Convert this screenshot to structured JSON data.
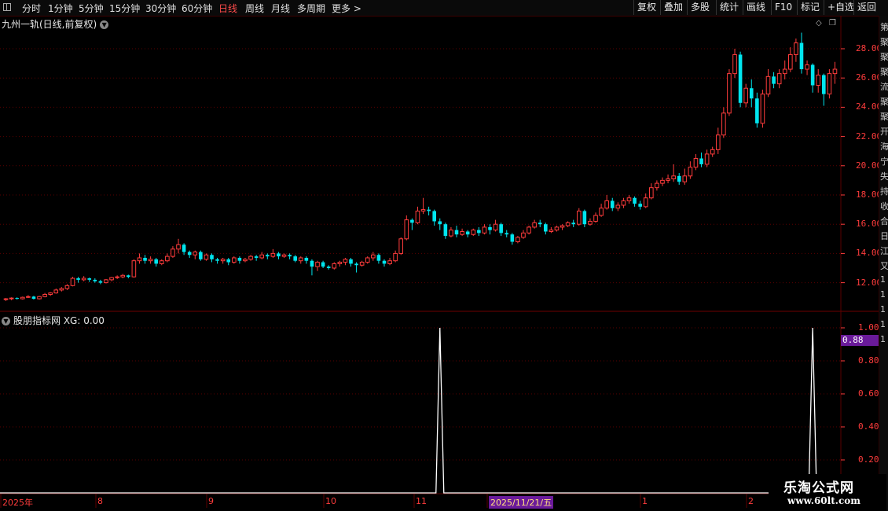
{
  "toolbar": {
    "periods": [
      "分时",
      "1分钟",
      "5分钟",
      "15分钟",
      "30分钟",
      "60分钟",
      "日线",
      "周线",
      "月线",
      "多周期",
      "更多 >"
    ],
    "active_index": 6,
    "right_buttons": [
      "复权",
      "叠加",
      "多股",
      "统计",
      "画线",
      "F10",
      "标记",
      "+自选",
      "返回"
    ]
  },
  "chart": {
    "title": "九州一轨(日线,前复权)",
    "indicator_title": "股朋指标网  XG: 0.00",
    "price_ticks": [
      "28.00",
      "26.00",
      "24.00",
      "22.00",
      "20.00",
      "18.00",
      "16.00",
      "14.00",
      "12.00"
    ],
    "indicator_ticks": [
      "1.00",
      "0.80",
      "0.60",
      "0.40",
      "0.20"
    ],
    "cursor_value": "0.88",
    "date_labels": [
      "2025年",
      "8",
      "9",
      "10",
      "11",
      "2025/11/21/五",
      "1",
      "2"
    ],
    "side_strip": [
      "第",
      "聚",
      "聚",
      "聚",
      "流",
      "聚",
      "聚",
      "开",
      "海",
      "宁",
      "失",
      "持",
      "收",
      "合",
      "日",
      "江",
      "又",
      "1",
      "1",
      "1",
      "1",
      "1"
    ],
    "watermark_title": "乐淘公式网",
    "watermark_url": "www.60lt.com",
    "colors": {
      "up": "#ff3c3c",
      "down": "#00e5ee",
      "signal": "#ffffff",
      "grid": "#5a0000",
      "tag": "#6a1a9a"
    }
  },
  "chart_data": [
    {
      "type": "candlestick",
      "title": "九州一轨(日线,前复权)",
      "ylim": [
        10.5,
        29.5
      ],
      "candles": [
        [
          10.85,
          10.9,
          10.75,
          10.95
        ],
        [
          10.9,
          10.95,
          10.8,
          11.0
        ],
        [
          10.95,
          10.9,
          10.85,
          11.0
        ],
        [
          10.9,
          11.0,
          10.85,
          11.05
        ],
        [
          11.0,
          11.05,
          10.95,
          11.15
        ],
        [
          11.05,
          10.9,
          10.85,
          11.1
        ],
        [
          10.9,
          11.05,
          10.85,
          11.1
        ],
        [
          11.05,
          11.2,
          11.0,
          11.3
        ],
        [
          11.2,
          11.3,
          11.1,
          11.35
        ],
        [
          11.3,
          11.5,
          11.25,
          11.6
        ],
        [
          11.5,
          11.6,
          11.4,
          11.7
        ],
        [
          11.6,
          11.8,
          11.5,
          11.9
        ],
        [
          11.8,
          12.3,
          11.75,
          12.4
        ],
        [
          12.3,
          12.2,
          12.0,
          12.4
        ],
        [
          12.2,
          12.3,
          12.1,
          12.45
        ],
        [
          12.3,
          12.2,
          12.05,
          12.35
        ],
        [
          12.2,
          12.1,
          12.0,
          12.3
        ],
        [
          12.1,
          12.0,
          11.9,
          12.2
        ],
        [
          12.0,
          12.2,
          11.95,
          12.25
        ],
        [
          12.2,
          12.35,
          12.1,
          12.4
        ],
        [
          12.35,
          12.4,
          12.25,
          12.5
        ],
        [
          12.4,
          12.5,
          12.3,
          12.6
        ],
        [
          12.5,
          12.4,
          12.3,
          12.55
        ],
        [
          12.4,
          13.5,
          12.35,
          13.6
        ],
        [
          13.5,
          13.7,
          13.3,
          14.0
        ],
        [
          13.7,
          13.5,
          13.3,
          13.9
        ],
        [
          13.5,
          13.6,
          13.3,
          13.8
        ],
        [
          13.6,
          13.3,
          13.1,
          13.7
        ],
        [
          13.3,
          13.5,
          13.2,
          13.6
        ],
        [
          13.5,
          13.8,
          13.4,
          14.0
        ],
        [
          13.8,
          14.3,
          13.7,
          14.5
        ],
        [
          14.3,
          14.6,
          14.0,
          15.0
        ],
        [
          14.6,
          14.1,
          13.9,
          14.7
        ],
        [
          14.1,
          13.9,
          13.7,
          14.2
        ],
        [
          13.9,
          14.1,
          13.6,
          14.2
        ],
        [
          14.1,
          13.6,
          13.5,
          14.2
        ],
        [
          13.6,
          13.9,
          13.5,
          14.0
        ],
        [
          13.9,
          13.6,
          13.4,
          14.0
        ],
        [
          13.6,
          13.5,
          13.3,
          13.7
        ],
        [
          13.5,
          13.6,
          13.3,
          13.7
        ],
        [
          13.6,
          13.4,
          13.2,
          13.7
        ],
        [
          13.4,
          13.7,
          13.3,
          13.8
        ],
        [
          13.7,
          13.5,
          13.3,
          13.8
        ],
        [
          13.5,
          13.6,
          13.4,
          13.7
        ],
        [
          13.6,
          13.8,
          13.5,
          13.9
        ],
        [
          13.8,
          13.7,
          13.5,
          13.9
        ],
        [
          13.7,
          13.9,
          13.6,
          14.1
        ],
        [
          13.9,
          13.8,
          13.6,
          14.0
        ],
        [
          13.8,
          14.0,
          13.7,
          14.3
        ],
        [
          14.0,
          13.8,
          13.6,
          14.1
        ],
        [
          13.8,
          13.9,
          13.7,
          14.0
        ],
        [
          13.9,
          13.8,
          13.6,
          14.0
        ],
        [
          13.8,
          13.5,
          13.4,
          13.9
        ],
        [
          13.5,
          13.7,
          13.3,
          13.8
        ],
        [
          13.7,
          13.5,
          13.3,
          13.8
        ],
        [
          13.5,
          13.1,
          12.5,
          13.6
        ],
        [
          13.1,
          13.4,
          12.8,
          13.5
        ],
        [
          13.4,
          13.1,
          13.0,
          13.5
        ],
        [
          13.1,
          13.0,
          12.9,
          13.2
        ],
        [
          13.0,
          13.3,
          12.9,
          13.4
        ],
        [
          13.3,
          13.4,
          13.1,
          13.5
        ],
        [
          13.4,
          13.6,
          13.2,
          13.7
        ],
        [
          13.6,
          13.3,
          13.1,
          13.7
        ],
        [
          13.3,
          13.2,
          12.7,
          13.4
        ],
        [
          13.2,
          13.4,
          13.1,
          13.5
        ],
        [
          13.4,
          13.7,
          13.3,
          13.8
        ],
        [
          13.7,
          13.9,
          13.5,
          14.1
        ],
        [
          13.9,
          13.5,
          13.3,
          14.0
        ],
        [
          13.5,
          13.3,
          13.1,
          13.6
        ],
        [
          13.3,
          13.5,
          13.2,
          13.7
        ],
        [
          13.5,
          14.0,
          13.4,
          14.2
        ],
        [
          14.0,
          15.0,
          13.9,
          15.1
        ],
        [
          15.0,
          16.3,
          14.9,
          16.6
        ],
        [
          16.3,
          16.1,
          15.6,
          16.4
        ],
        [
          16.1,
          16.9,
          16.0,
          17.2
        ],
        [
          16.9,
          17.0,
          16.7,
          17.8
        ],
        [
          17.0,
          16.9,
          16.6,
          17.2
        ],
        [
          16.9,
          16.2,
          15.9,
          17.0
        ],
        [
          16.2,
          16.0,
          15.6,
          16.4
        ],
        [
          16.0,
          15.2,
          15.0,
          16.1
        ],
        [
          15.2,
          15.6,
          15.1,
          15.8
        ],
        [
          15.6,
          15.3,
          15.1,
          15.9
        ],
        [
          15.3,
          15.5,
          15.2,
          15.7
        ],
        [
          15.5,
          15.3,
          15.1,
          15.6
        ],
        [
          15.3,
          15.6,
          15.2,
          15.7
        ],
        [
          15.6,
          15.4,
          15.2,
          15.8
        ],
        [
          15.4,
          15.8,
          15.3,
          16.0
        ],
        [
          15.8,
          15.6,
          15.3,
          16.0
        ],
        [
          15.6,
          16.0,
          15.5,
          16.3
        ],
        [
          16.0,
          15.4,
          15.2,
          16.1
        ],
        [
          15.4,
          15.3,
          15.1,
          15.6
        ],
        [
          15.3,
          14.8,
          14.6,
          15.4
        ],
        [
          14.8,
          15.1,
          14.7,
          15.2
        ],
        [
          15.1,
          15.4,
          15.0,
          15.6
        ],
        [
          15.4,
          15.8,
          15.3,
          15.9
        ],
        [
          15.8,
          16.1,
          15.7,
          16.3
        ],
        [
          16.1,
          16.0,
          15.8,
          16.3
        ],
        [
          16.0,
          15.5,
          15.3,
          16.1
        ],
        [
          15.5,
          15.6,
          15.4,
          15.8
        ],
        [
          15.6,
          15.8,
          15.5,
          15.9
        ],
        [
          15.8,
          15.9,
          15.6,
          16.0
        ],
        [
          15.9,
          16.1,
          15.8,
          16.2
        ],
        [
          16.1,
          16.0,
          15.8,
          16.3
        ],
        [
          16.0,
          16.9,
          15.9,
          17.1
        ],
        [
          16.9,
          16.0,
          15.8,
          17.0
        ],
        [
          16.0,
          16.2,
          15.9,
          16.4
        ],
        [
          16.2,
          16.6,
          16.1,
          16.8
        ],
        [
          16.6,
          17.1,
          16.5,
          17.4
        ],
        [
          17.1,
          17.6,
          17.0,
          18.0
        ],
        [
          17.6,
          17.1,
          16.9,
          17.8
        ],
        [
          17.1,
          17.3,
          16.9,
          17.5
        ],
        [
          17.3,
          17.6,
          17.1,
          17.8
        ],
        [
          17.6,
          17.8,
          17.4,
          18.0
        ],
        [
          17.8,
          17.4,
          17.2,
          17.9
        ],
        [
          17.4,
          17.2,
          17.0,
          17.6
        ],
        [
          17.2,
          17.8,
          17.1,
          18.1
        ],
        [
          17.8,
          18.5,
          17.7,
          18.8
        ],
        [
          18.5,
          18.8,
          18.3,
          19.0
        ],
        [
          18.8,
          19.0,
          18.6,
          19.2
        ],
        [
          19.0,
          19.1,
          18.8,
          19.4
        ],
        [
          19.1,
          19.3,
          18.9,
          20.1
        ],
        [
          19.3,
          18.9,
          18.7,
          19.5
        ],
        [
          18.9,
          19.3,
          18.7,
          19.8
        ],
        [
          19.3,
          19.9,
          19.1,
          20.3
        ],
        [
          19.9,
          20.5,
          19.7,
          20.8
        ],
        [
          20.5,
          20.1,
          19.9,
          20.9
        ],
        [
          20.1,
          20.8,
          19.9,
          21.1
        ],
        [
          20.8,
          21.1,
          20.6,
          21.3
        ],
        [
          21.1,
          22.1,
          20.8,
          22.6
        ],
        [
          22.1,
          23.6,
          21.9,
          24.0
        ],
        [
          23.6,
          26.3,
          23.4,
          26.6
        ],
        [
          26.3,
          27.6,
          26.0,
          28.0
        ],
        [
          27.6,
          24.3,
          24.0,
          27.8
        ],
        [
          24.3,
          25.3,
          24.0,
          25.6
        ],
        [
          25.3,
          24.6,
          24.0,
          25.9
        ],
        [
          24.6,
          22.9,
          22.6,
          25.0
        ],
        [
          22.9,
          24.9,
          22.6,
          25.2
        ],
        [
          24.9,
          26.1,
          24.7,
          26.6
        ],
        [
          26.1,
          25.6,
          25.3,
          26.4
        ],
        [
          25.6,
          26.3,
          25.3,
          26.6
        ],
        [
          26.3,
          26.6,
          25.9,
          27.2
        ],
        [
          26.6,
          27.6,
          26.4,
          28.1
        ],
        [
          27.6,
          28.4,
          27.1,
          28.7
        ],
        [
          28.4,
          26.6,
          26.3,
          29.1
        ],
        [
          26.6,
          26.9,
          26.2,
          27.2
        ],
        [
          26.9,
          25.5,
          25.0,
          27.0
        ],
        [
          25.5,
          26.2,
          25.0,
          26.6
        ],
        [
          26.2,
          24.9,
          24.1,
          26.3
        ],
        [
          24.9,
          26.3,
          24.6,
          26.6
        ],
        [
          26.3,
          26.6,
          25.6,
          27.1
        ]
      ]
    },
    {
      "type": "line",
      "title": "股朋指标网",
      "ylim": [
        0,
        1.05
      ],
      "spikes": [
        {
          "index": 78,
          "value": 1.0
        },
        {
          "index": 145,
          "value": 1.0
        }
      ],
      "baseline": 0
    }
  ]
}
